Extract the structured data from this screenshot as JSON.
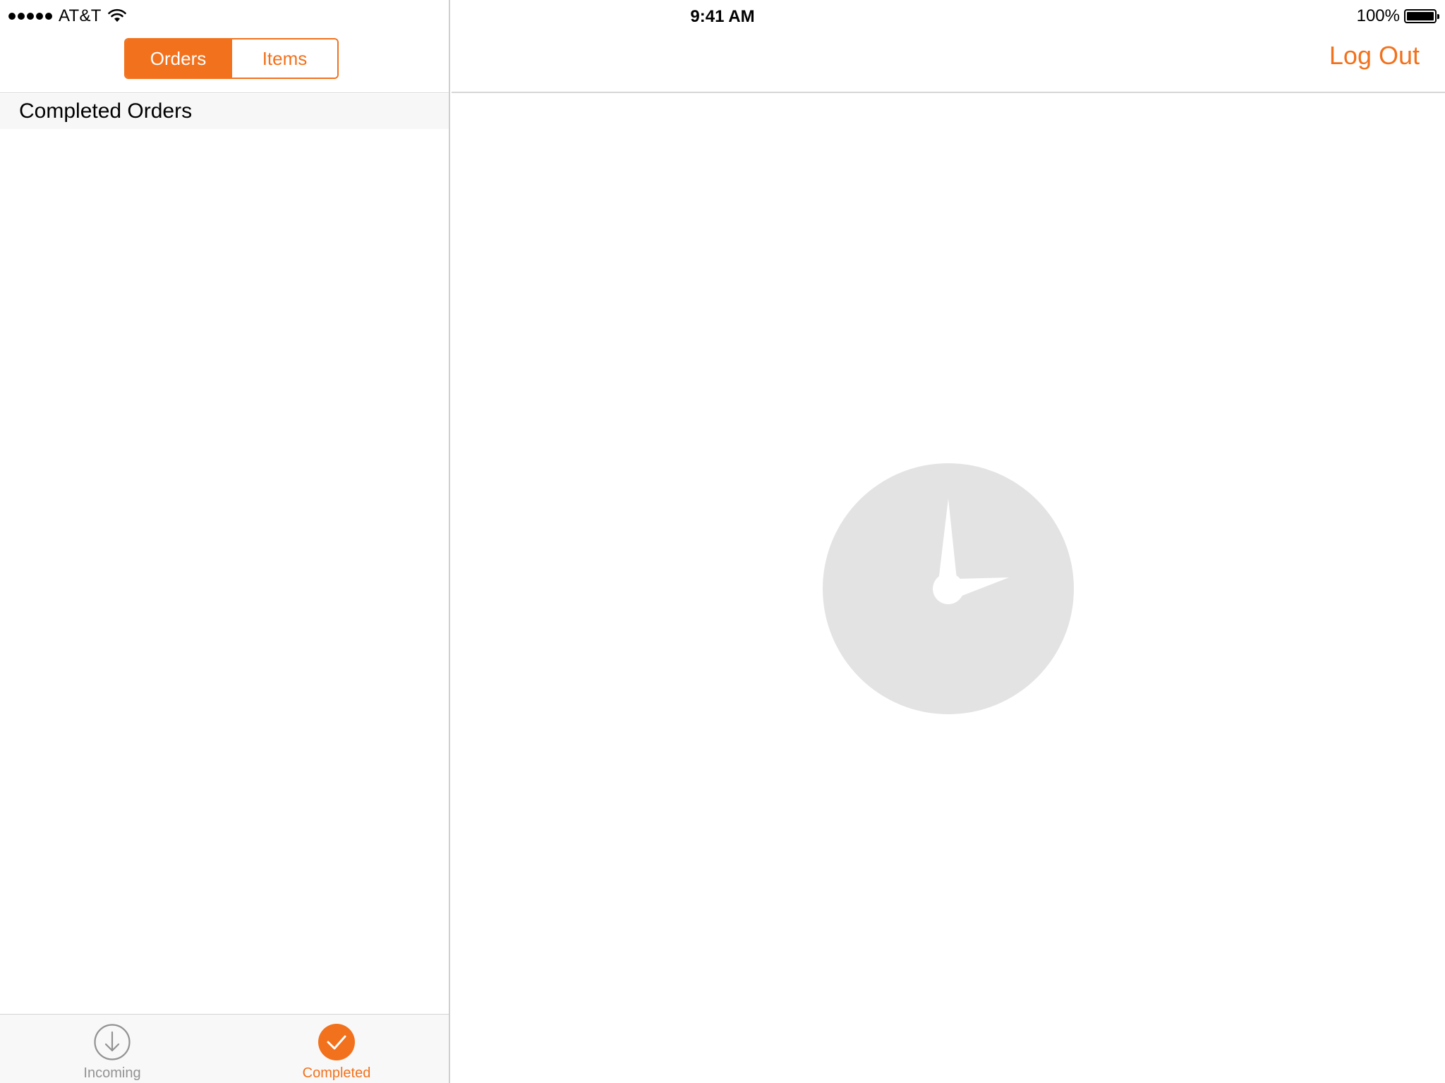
{
  "status_bar": {
    "carrier": "AT&T",
    "signal_icon": "signal-dots-icon",
    "wifi_icon": "wifi-icon",
    "time": "9:41 AM",
    "battery_percent": "100%",
    "battery_level": 1.0
  },
  "master": {
    "segments": [
      {
        "label": "Orders",
        "selected": true
      },
      {
        "label": "Items",
        "selected": false
      }
    ],
    "section_header": "Completed Orders",
    "tabs": [
      {
        "label": "Incoming",
        "icon": "arrow-down-circle-icon",
        "active": false
      },
      {
        "label": "Completed",
        "icon": "checkmark-circle-icon",
        "active": true
      }
    ]
  },
  "detail": {
    "logout_label": "Log Out",
    "placeholder_icon": "clock-icon"
  },
  "colors": {
    "accent": "#f2711c",
    "inactive": "#929292",
    "placeholder": "#e3e3e3"
  }
}
